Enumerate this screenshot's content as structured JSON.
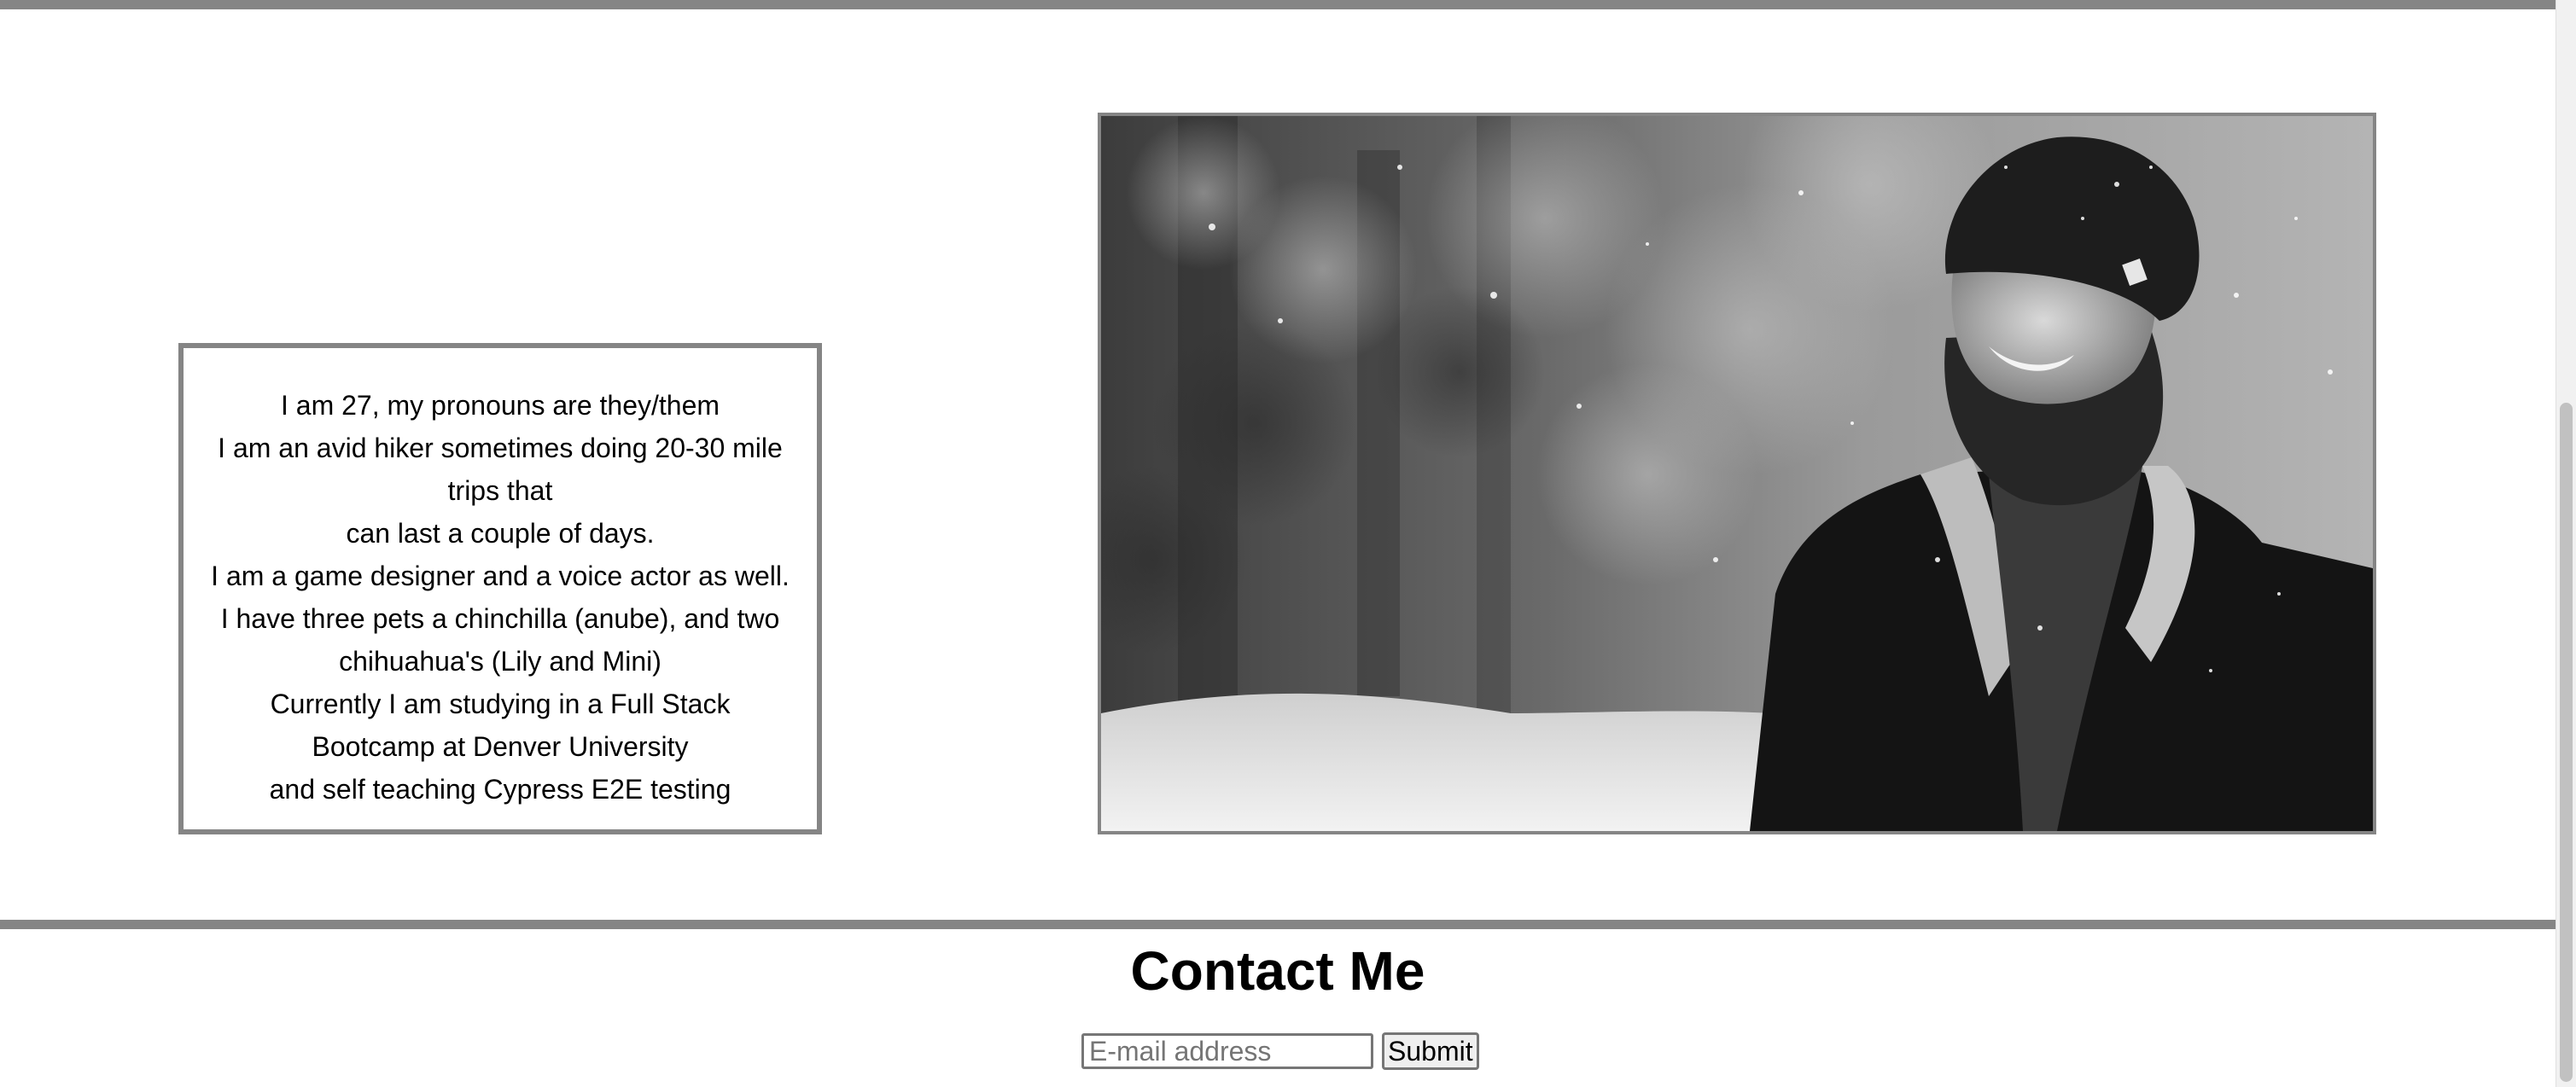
{
  "about": {
    "lines": [
      "I am 27, my pronouns are they/them",
      "I am an avid hiker sometimes doing 20-30 mile",
      "trips that",
      "can last a couple of days.",
      "I am a game designer and a voice actor as well.",
      "I have three pets a chinchilla (anube), and two",
      "chihuahua's (Lily and Mini)",
      "Currently I am studying in a Full Stack",
      "Bootcamp at Denver University",
      "and self teaching Cypress E2E testing"
    ]
  },
  "photo": {
    "subject": "black-and-white portrait of a bearded man in a knit beanie and sherpa-collar coat smiling in the snow"
  },
  "contact": {
    "title": "Contact Me",
    "email_placeholder": "E-mail address",
    "email_value": "",
    "submit_label": "Submit"
  },
  "colors": {
    "rule": "#858585",
    "background": "#ffffff",
    "text": "#000000"
  }
}
